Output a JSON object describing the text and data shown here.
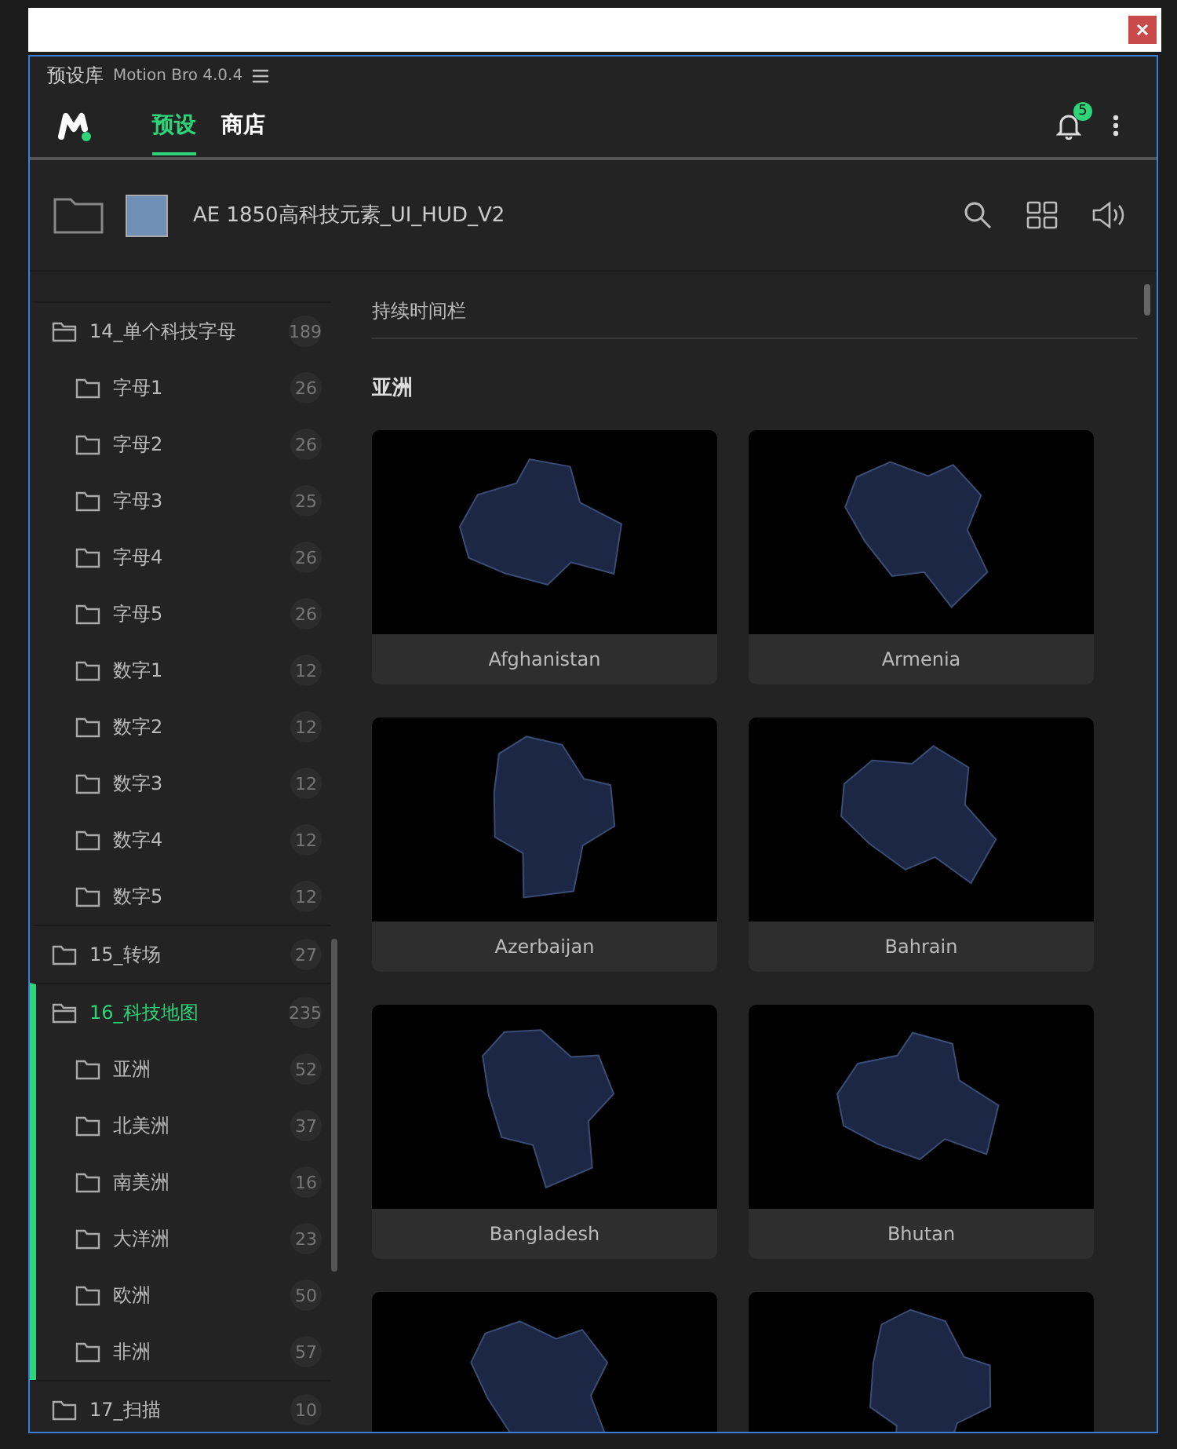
{
  "window": {
    "title": "预设库",
    "version": "Motion Bro 4.0.4"
  },
  "nav": {
    "tabs": [
      {
        "label": "预设",
        "selected": true
      },
      {
        "label": "商店",
        "selected": false
      }
    ],
    "notification_count": "5"
  },
  "pack": {
    "name": "AE 1850高科技元素_UI_HUD_V2"
  },
  "sidebar": {
    "items": [
      {
        "label": "14_单个科技字母",
        "count": "189",
        "selected": false,
        "expanded": true,
        "children": [
          {
            "label": "字母1",
            "count": "26"
          },
          {
            "label": "字母2",
            "count": "26"
          },
          {
            "label": "字母3",
            "count": "25"
          },
          {
            "label": "字母4",
            "count": "26"
          },
          {
            "label": "字母5",
            "count": "26"
          },
          {
            "label": "数字1",
            "count": "12"
          },
          {
            "label": "数字2",
            "count": "12"
          },
          {
            "label": "数字3",
            "count": "12"
          },
          {
            "label": "数字4",
            "count": "12"
          },
          {
            "label": "数字5",
            "count": "12"
          }
        ]
      },
      {
        "label": "15_转场",
        "count": "27",
        "selected": false,
        "expanded": false
      },
      {
        "label": "16_科技地图",
        "count": "235",
        "selected": true,
        "expanded": true,
        "children": [
          {
            "label": "亚洲",
            "count": "52"
          },
          {
            "label": "北美洲",
            "count": "37"
          },
          {
            "label": "南美洲",
            "count": "16"
          },
          {
            "label": "大洋洲",
            "count": "23"
          },
          {
            "label": "欧洲",
            "count": "50"
          },
          {
            "label": "非洲",
            "count": "57"
          }
        ]
      },
      {
        "label": "17_扫描",
        "count": "10",
        "selected": false,
        "expanded": false
      }
    ]
  },
  "content": {
    "section_row": "持续时间栏",
    "heading": "亚洲",
    "cards": [
      {
        "kind": "titled",
        "name": "Afghanistan"
      },
      {
        "kind": "titled",
        "name": "Armenia"
      },
      {
        "kind": "titled",
        "name": "Azerbaijan"
      },
      {
        "kind": "titled",
        "name": "Bahrain"
      },
      {
        "kind": "titled",
        "name": "Bangladesh"
      },
      {
        "kind": "titled",
        "name": "Bhutan"
      },
      {
        "kind": "preview_only"
      },
      {
        "kind": "preview_only"
      }
    ]
  }
}
